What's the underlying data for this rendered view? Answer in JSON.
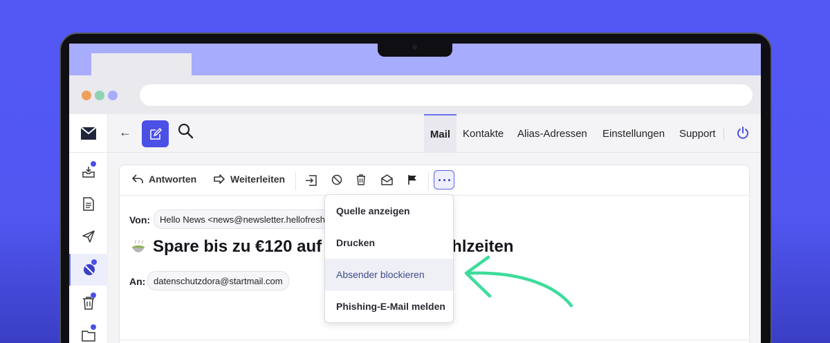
{
  "app": {
    "nav": {
      "mail": "Mail",
      "kontakte": "Kontakte",
      "alias": "Alias-Adressen",
      "einstellungen": "Einstellungen",
      "support": "Support"
    },
    "back_symbol": "←"
  },
  "toolbar": {
    "reply_label": "Antworten",
    "forward_label": "Weiterleiten"
  },
  "message": {
    "from_label": "Von:",
    "from_value": "Hello News <news@newsletter.hellofresh.de>",
    "subject": "Spare bis zu €120 auf deine ersten Mahlzeiten",
    "to_label": "An:",
    "to_value": "datenschutzdora@startmail.com"
  },
  "dropdown": {
    "items": [
      "Quelle anzeigen",
      "Drucken",
      "Absender blockieren",
      "Phishing-E-Mail melden"
    ],
    "highlighted_index": 2
  },
  "colors": {
    "accent": "#4b50e6",
    "background": "#5358f5",
    "arrow": "#3ddc9b"
  }
}
